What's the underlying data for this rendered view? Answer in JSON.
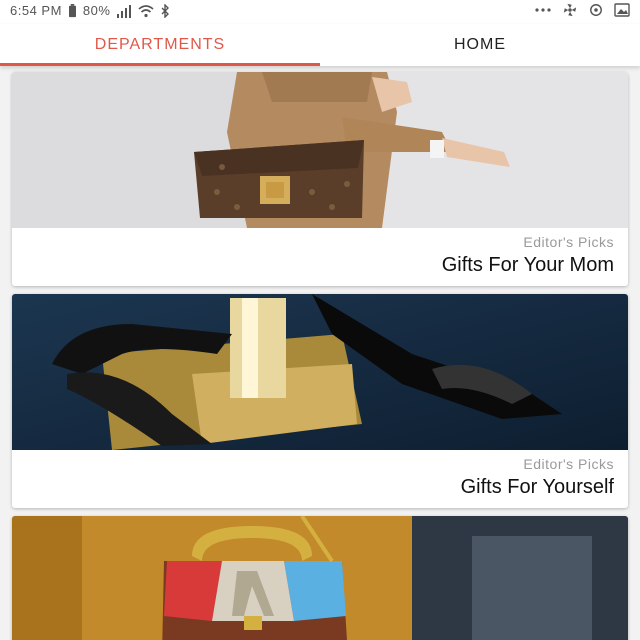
{
  "status_bar": {
    "time": "6:54 PM",
    "battery": "80%",
    "icons": [
      "image-icon",
      "sync-icon",
      "pinwheel-icon",
      "more-icon",
      "bluetooth-icon",
      "wifi-icon",
      "signal-icon",
      "battery-icon"
    ]
  },
  "tabs": [
    {
      "label": "DEPARTMENTS",
      "active": true
    },
    {
      "label": "HOME",
      "active": false
    }
  ],
  "colors": {
    "accent": "#e0584a"
  },
  "cards": [
    {
      "subtitle": "Editor's Picks",
      "title": "Gifts For Your Mom",
      "image": "woman-with-handbag"
    },
    {
      "subtitle": "Editor's Picks",
      "title": "Gifts For Yourself",
      "image": "black-heels-on-gold-block"
    },
    {
      "subtitle": "",
      "title": "",
      "image": "colorful-handbag-on-orange-coat"
    }
  ]
}
